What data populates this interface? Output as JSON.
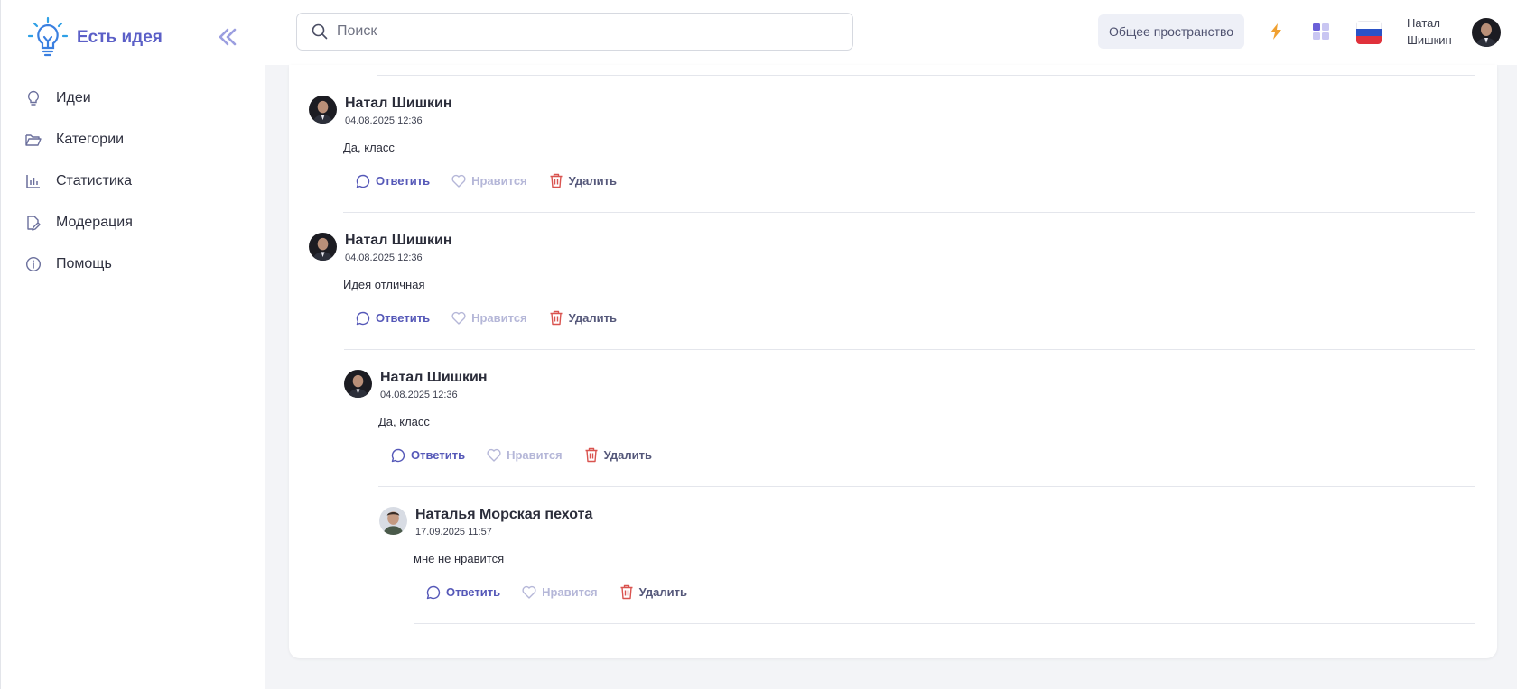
{
  "app": {
    "name": "Есть идея"
  },
  "sidebar": {
    "items": [
      {
        "label": "Идеи",
        "icon": "lightbulb-icon"
      },
      {
        "label": "Категории",
        "icon": "folder-open-icon"
      },
      {
        "label": "Статистика",
        "icon": "bar-chart-icon"
      },
      {
        "label": "Модерация",
        "icon": "edit-document-icon"
      },
      {
        "label": "Помощь",
        "icon": "info-circle-icon"
      }
    ]
  },
  "topbar": {
    "search_placeholder": "Поиск",
    "workspace_label": "Общее пространство",
    "user_first": "Натал",
    "user_last": "Шишкин"
  },
  "actions": {
    "reply": "Ответить",
    "like": "Нравится",
    "delete": "Удалить"
  },
  "comments": [
    {
      "author": "Натал Шишкин",
      "date": "04.08.2025 12:36",
      "text": "Да, класс"
    },
    {
      "author": "Натал Шишкин",
      "date": "04.08.2025 12:36",
      "text": "Идея отличная"
    },
    {
      "author": "Натал Шишкин",
      "date": "04.08.2025 12:36",
      "text": "Да, класс"
    },
    {
      "author": "Наталья Морская пехота",
      "date": "17.09.2025 11:57",
      "text": "мне не нравится"
    }
  ],
  "colors": {
    "accent": "#5b5fc7",
    "flash": "#f0a030",
    "delete": "#d9534f",
    "like": "#b5b7d8"
  }
}
